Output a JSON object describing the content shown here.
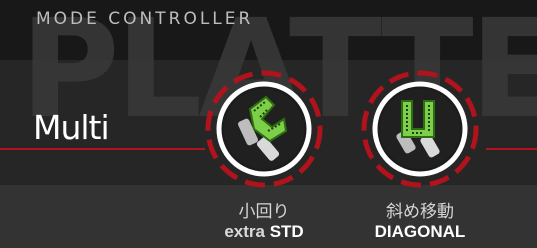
{
  "header": {
    "title": "MODE CONTROLLER",
    "watermark": "PLATTER"
  },
  "mode": {
    "current": "Multi"
  },
  "buttons": [
    {
      "label_jp": "小回り",
      "label_en_prefix": "extra ",
      "label_en_strong": "STD",
      "icon": "platter-turn-icon"
    },
    {
      "label_jp": "斜め移動",
      "label_en_prefix": "",
      "label_en_strong": "DIAGONAL",
      "icon": "platter-diagonal-icon"
    }
  ],
  "colors": {
    "accent_red": "#b0131c",
    "icon_green": "#7dcf4a",
    "ring_white": "#ffffff",
    "background": "#2c2c2c"
  }
}
